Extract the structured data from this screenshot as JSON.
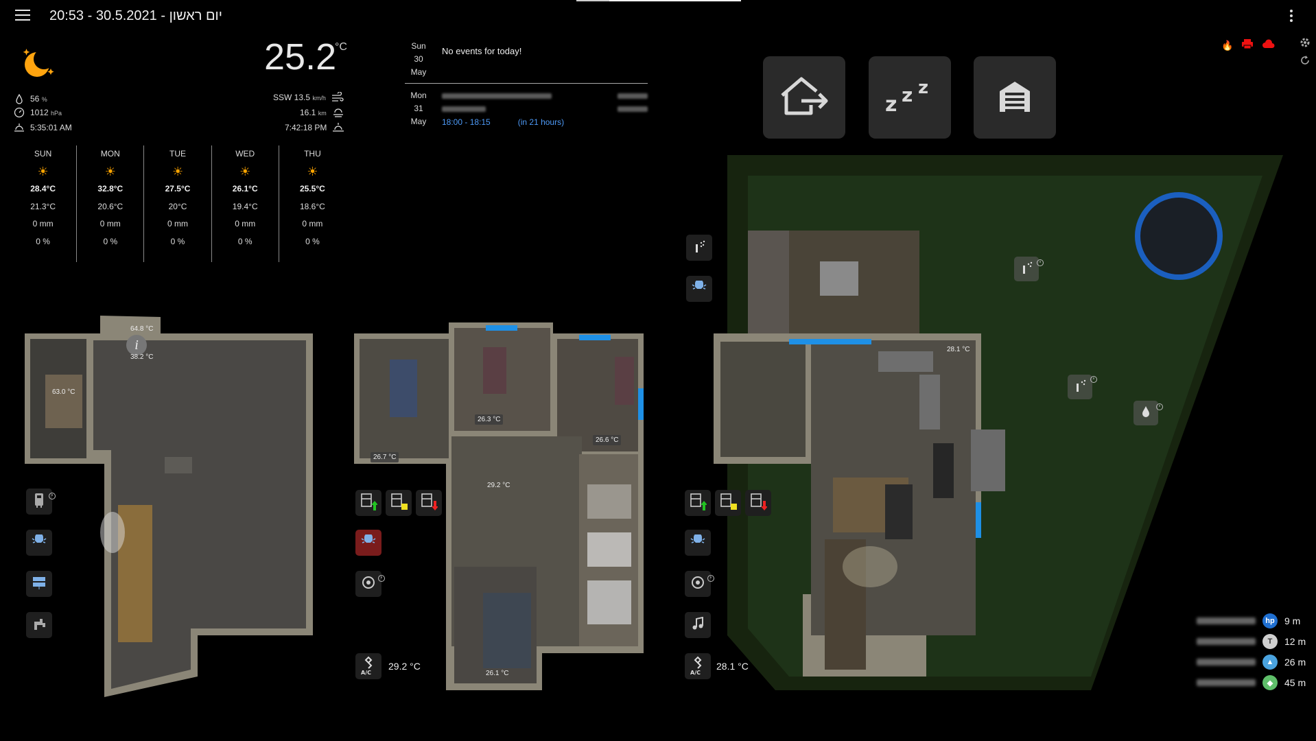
{
  "header": {
    "title": "20:53 - 30.5.2021 - יום ראשון"
  },
  "weather": {
    "temperature": "25.2",
    "unit": "°C",
    "humidity": "56",
    "humidity_unit": "%",
    "pressure": "1012",
    "pressure_unit": "hPa",
    "sunrise": "5:35:01 AM",
    "wind": "SSW 13.5",
    "wind_unit": "km/h",
    "visibility": "16.1",
    "visibility_unit": "km",
    "sunset": "7:42:18 PM",
    "forecast": [
      {
        "day": "SUN",
        "hi": "28.4°C",
        "lo": "21.3°C",
        "rain": "0 mm",
        "prob": "0 %"
      },
      {
        "day": "MON",
        "hi": "32.8°C",
        "lo": "20.6°C",
        "rain": "0 mm",
        "prob": "0 %"
      },
      {
        "day": "TUE",
        "hi": "27.5°C",
        "lo": "20°C",
        "rain": "0 mm",
        "prob": "0 %"
      },
      {
        "day": "WED",
        "hi": "26.1°C",
        "lo": "19.4°C",
        "rain": "0 mm",
        "prob": "0 %"
      },
      {
        "day": "THU",
        "hi": "25.5°C",
        "lo": "18.6°C",
        "rain": "0 mm",
        "prob": "0 %"
      }
    ]
  },
  "calendar": {
    "today": {
      "dow": "Sun",
      "date": "30",
      "month": "May",
      "text": "No events for today!"
    },
    "tomorrow": {
      "dow": "Mon",
      "date": "31",
      "month": "May",
      "time": "18:00 - 18:15",
      "relative": "(in 21 hours)"
    }
  },
  "floor1": {
    "temps": {
      "a": "64.8 °C",
      "b": "38.2 °C",
      "c": "63.0 °C"
    }
  },
  "floor2": {
    "temps": {
      "r1": "26.7 °C",
      "r2": "26.3 °C",
      "r3": "26.6 °C",
      "r4": "29.2 °C",
      "r5": "26.1 °C"
    },
    "ac_temp": "29.2 °C",
    "ac_label": "A/C"
  },
  "floor3": {
    "temps": {
      "r1": "28.1 °C"
    },
    "ac_temp": "28.1 °C",
    "ac_label": "A/C"
  },
  "travel": [
    {
      "icon": "hp-icon",
      "label": "hp",
      "color": "#1f6fd1",
      "val": "9 m"
    },
    {
      "icon": "toyota-icon",
      "label": "T",
      "color": "#cfcfcf",
      "val": "12 m"
    },
    {
      "icon": "building-icon",
      "label": "▲",
      "color": "#4aa3df",
      "val": "26 m"
    },
    {
      "icon": "map-icon",
      "label": "◆",
      "color": "#5fbf6a",
      "val": "45 m"
    }
  ]
}
